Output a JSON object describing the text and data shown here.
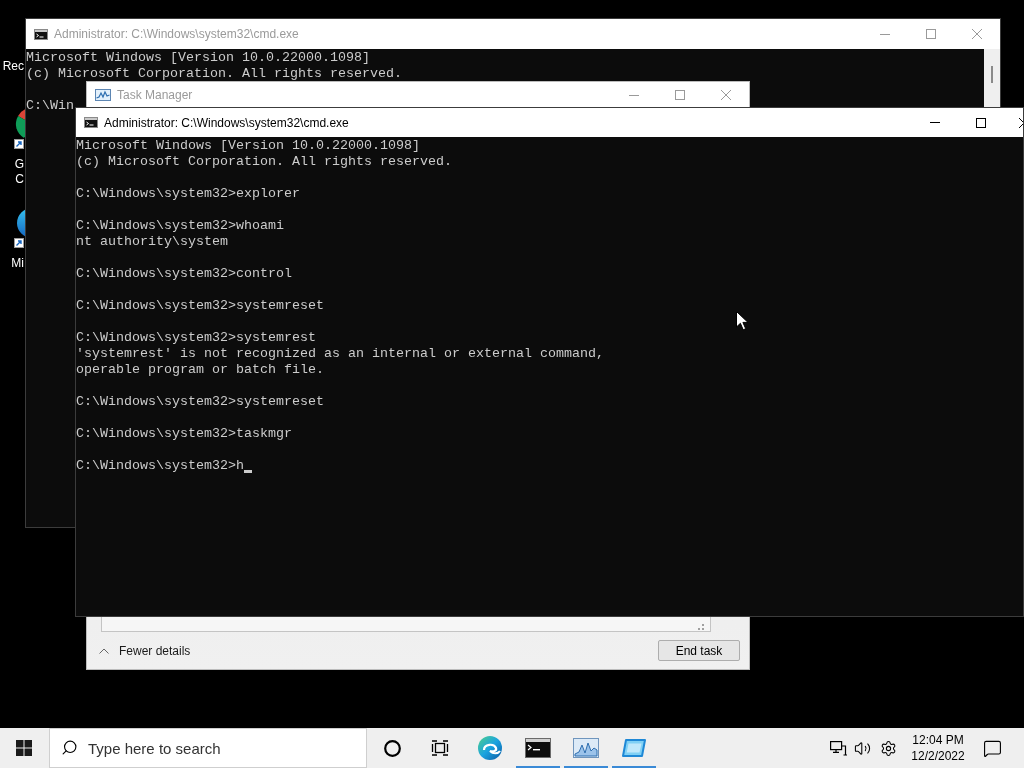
{
  "desktop_icons": [
    {
      "kind": "recycle_bin",
      "label_lines": [
        "Rec"
      ]
    },
    {
      "kind": "chrome",
      "label_lines": [
        "G",
        "C"
      ]
    },
    {
      "kind": "edge",
      "label_lines": [
        "Mi"
      ]
    }
  ],
  "windows": [
    {
      "kind": "console",
      "title": "Administrator: C:\\Windows\\system32\\cmd.exe",
      "active": false,
      "blocks": [
        [
          "Microsoft Windows [Version 10.0.22000.1098]",
          "(c) Microsoft Corporation. All rights reserved."
        ],
        [
          "C:\\Win"
        ]
      ]
    },
    {
      "kind": "task_manager",
      "title": "Task Manager",
      "active": false,
      "footer": {
        "details_toggle": "Fewer details",
        "end_task_button": "End task"
      }
    },
    {
      "kind": "console",
      "title": "Administrator: C:\\Windows\\system32\\cmd.exe",
      "active": true,
      "cursor": true,
      "blocks": [
        [
          "Microsoft Windows [Version 10.0.22000.1098]",
          "(c) Microsoft Corporation. All rights reserved."
        ],
        [
          "C:\\Windows\\system32>explorer"
        ],
        [
          "C:\\Windows\\system32>whoami",
          "nt authority\\system"
        ],
        [
          "C:\\Windows\\system32>control"
        ],
        [
          "C:\\Windows\\system32>systemreset"
        ],
        [
          "C:\\Windows\\system32>systemrest",
          "'systemrest' is not recognized as an internal or external command,",
          "operable program or batch file."
        ],
        [
          "C:\\Windows\\system32>systemreset"
        ],
        [
          "C:\\Windows\\system32>taskmgr"
        ],
        [
          "C:\\Windows\\system32>h"
        ]
      ]
    }
  ],
  "taskbar": {
    "search": {
      "placeholder": "Type here to search"
    },
    "buttons": [
      {
        "kind": "cortana"
      },
      {
        "kind": "task_view"
      }
    ],
    "apps": [
      {
        "kind": "edge",
        "running": false
      },
      {
        "kind": "console",
        "running": true
      },
      {
        "kind": "task_manager",
        "running": true
      },
      {
        "kind": "remote_desktop",
        "running": true
      }
    ],
    "clock": {
      "time": "12:04 PM",
      "date": "12/2/2022"
    }
  }
}
